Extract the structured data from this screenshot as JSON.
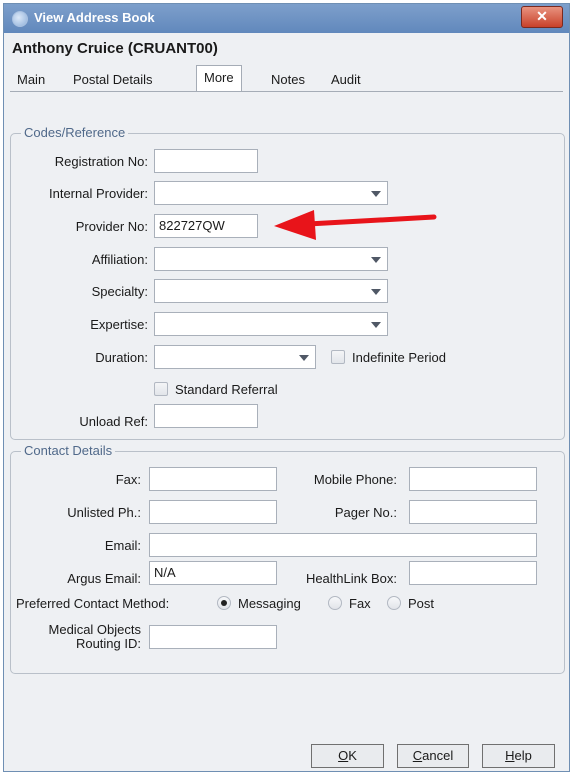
{
  "window": {
    "title": "View Address Book",
    "close_glyph": "✕"
  },
  "contact": {
    "name": "Anthony Cruice (CRUANT00)"
  },
  "tabs": [
    {
      "label": "Main"
    },
    {
      "label": "Postal Details"
    },
    {
      "label": "More"
    },
    {
      "label": "Notes"
    },
    {
      "label": "Audit"
    }
  ],
  "codes": {
    "group_title": "Codes/Reference",
    "registration_label": "Registration No:",
    "registration_value": "",
    "internal_provider_label": "Internal Provider:",
    "internal_provider_value": "",
    "provider_no_label": "Provider No:",
    "provider_no_value": "822727QW",
    "affiliation_label": "Affiliation:",
    "affiliation_value": "",
    "specialty_label": "Specialty:",
    "specialty_value": "",
    "expertise_label": "Expertise:",
    "expertise_value": "",
    "duration_label": "Duration:",
    "duration_value": "",
    "indefinite_label": "Indefinite Period",
    "standard_referral_label": "Standard Referral",
    "unload_ref_label": "Unload Ref:",
    "unload_ref_value": ""
  },
  "contact_details": {
    "group_title": "Contact Details",
    "fax_label": "Fax:",
    "fax_value": "",
    "mobile_label": "Mobile Phone:",
    "mobile_value": "",
    "unlisted_label": "Unlisted Ph.:",
    "unlisted_value": "",
    "pager_label": "Pager No.:",
    "pager_value": "",
    "email_label": "Email:",
    "email_value": "",
    "argus_label": "Argus Email:",
    "argus_value": "N/A",
    "healthlink_label": "HealthLink Box:",
    "healthlink_value": "",
    "preferred_label": "Preferred Contact Method:",
    "preferred_options": [
      "Messaging",
      "Fax",
      "Post"
    ],
    "preferred_selected": "Messaging",
    "mo_label_line1": "Medical Objects",
    "mo_label_line2": "Routing ID:",
    "mo_value": ""
  },
  "buttons": {
    "ok_key": "O",
    "ok_rest": "K",
    "cancel_key": "C",
    "cancel_rest": "ancel",
    "help_key": "H",
    "help_rest": "elp"
  },
  "colors": {
    "annotation_arrow": "#e8141a",
    "titlebar": "#6f93c4"
  }
}
